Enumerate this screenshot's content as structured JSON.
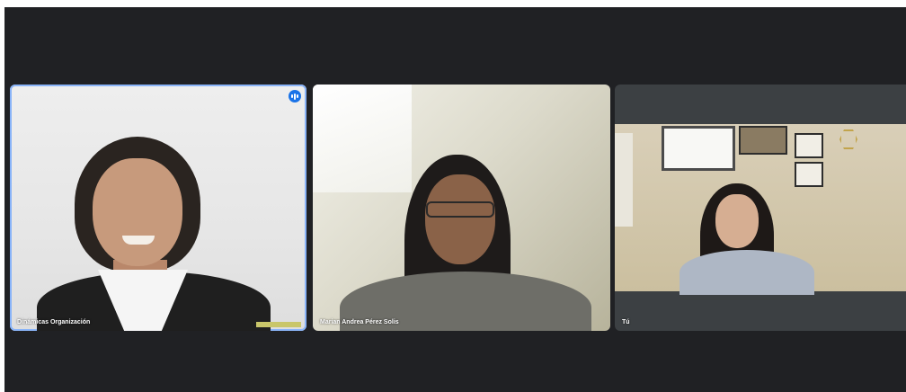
{
  "app": {
    "type": "video-call-grid"
  },
  "participants": [
    {
      "name": "Dinámicas Organización",
      "speaking": true,
      "self": false
    },
    {
      "name": "Marian Andrea Pérez Solis",
      "speaking": false,
      "self": false
    },
    {
      "name": "Tú",
      "speaking": false,
      "self": true
    }
  ],
  "colors": {
    "background": "#202124",
    "active_speaker_border": "#8ab4f8",
    "speaking_badge": "#1a73e8",
    "tile_placeholder": "#3c4043",
    "label_text": "#ffffff"
  },
  "icons": {
    "speaking_indicator": "audio-level-icon"
  }
}
